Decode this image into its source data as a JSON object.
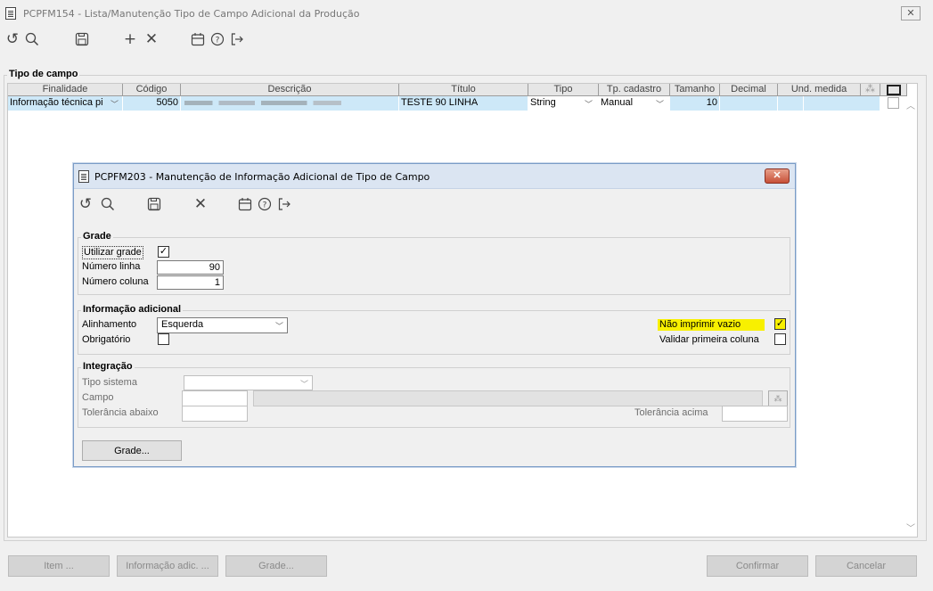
{
  "window": {
    "title": "PCPFM154 - Lista/Manutenção Tipo de Campo Adicional da Produção",
    "close": "✕"
  },
  "toolbar": {
    "undo": "↺",
    "search": "🔍",
    "save": "💾",
    "add": "+",
    "delete": "✕",
    "calendar": "📅",
    "help": "?",
    "exit": "[→"
  },
  "group": {
    "label": "Tipo de campo"
  },
  "table": {
    "headers": [
      "Finalidade",
      "Código",
      "Descrição",
      "Título",
      "Tipo",
      "Tp. cadastro",
      "Tamanho",
      "Decimal",
      "Und. medida"
    ],
    "row": {
      "finalidade": "Informação técnica pi",
      "codigo": "5050",
      "titulo": "TESTE 90 LINHA",
      "tipo": "String",
      "tp_cadastro": "Manual",
      "tamanho": "10",
      "decimal": "",
      "und_medida": ""
    }
  },
  "dialog": {
    "title": "PCPFM203 - Manutenção de Informação Adicional de Tipo de Campo",
    "grade": {
      "label": "Grade",
      "utilizar_label": "Utilizar grade",
      "utilizar_checked": "✓",
      "numero_linha_label": "Número linha",
      "numero_linha": "90",
      "numero_coluna_label": "Número coluna",
      "numero_coluna": "1"
    },
    "info": {
      "label": "Informação adicional",
      "alinhamento_label": "Alinhamento",
      "alinhamento": "Esquerda",
      "obrigatorio_label": "Obrigatório",
      "nao_imprimir_label": "Não imprimir vazio",
      "nao_imprimir_checked": "✓",
      "validar_label": "Validar primeira coluna"
    },
    "integracao": {
      "label": "Integração",
      "tipo_sistema_label": "Tipo sistema",
      "campo_label": "Campo",
      "tol_abaixo_label": "Tolerância abaixo",
      "tol_acima_label": "Tolerância acima"
    },
    "grade_button": "Grade..."
  },
  "footer": {
    "item": "Item ...",
    "info_adic": "Informação adic. ...",
    "grade": "Grade...",
    "confirmar": "Confirmar",
    "cancelar": "Cancelar"
  }
}
